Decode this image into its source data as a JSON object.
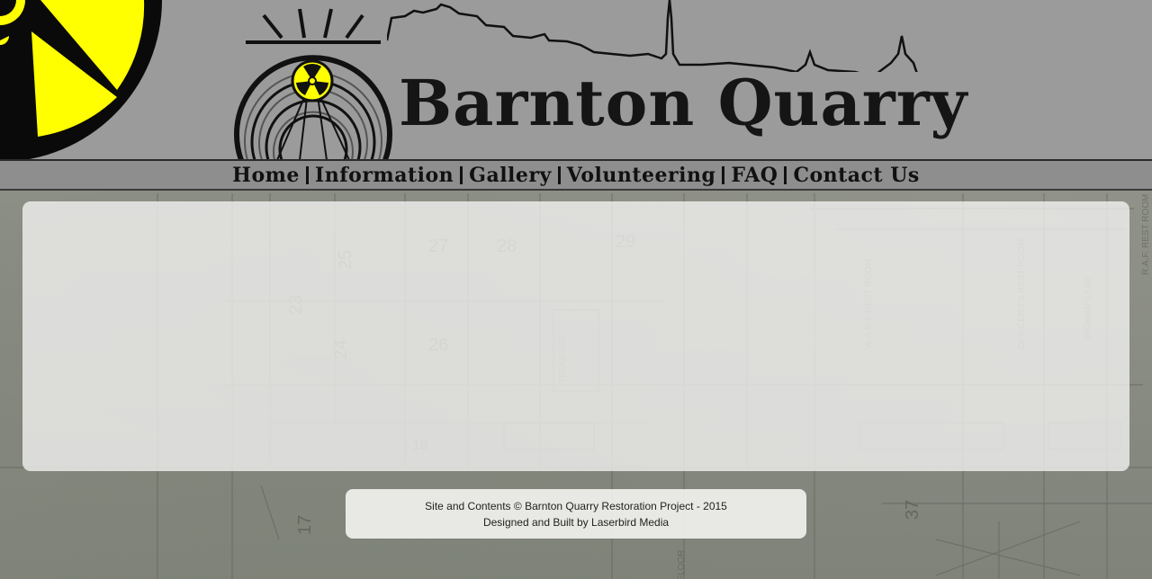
{
  "site": {
    "title": "Barnton Quarry"
  },
  "nav": {
    "items": [
      {
        "label": "Home"
      },
      {
        "label": "Information"
      },
      {
        "label": "Gallery"
      },
      {
        "label": "Volunteering"
      },
      {
        "label": "FAQ"
      },
      {
        "label": "Contact Us"
      }
    ]
  },
  "footer": {
    "line1": "Site and Contents © Barnton Quarry Restoration Project - 2015",
    "line2": "Designed and Built by Laserbird Media"
  },
  "colors": {
    "header_bg": "#9b9b9b",
    "accent_yellow": "#ffff00",
    "text_dark": "#111111"
  },
  "icons": {
    "corner": "radiation-trefoil-icon",
    "logo": "tunnel-radiation-logo-icon",
    "skyline": "city-skyline-icon"
  }
}
